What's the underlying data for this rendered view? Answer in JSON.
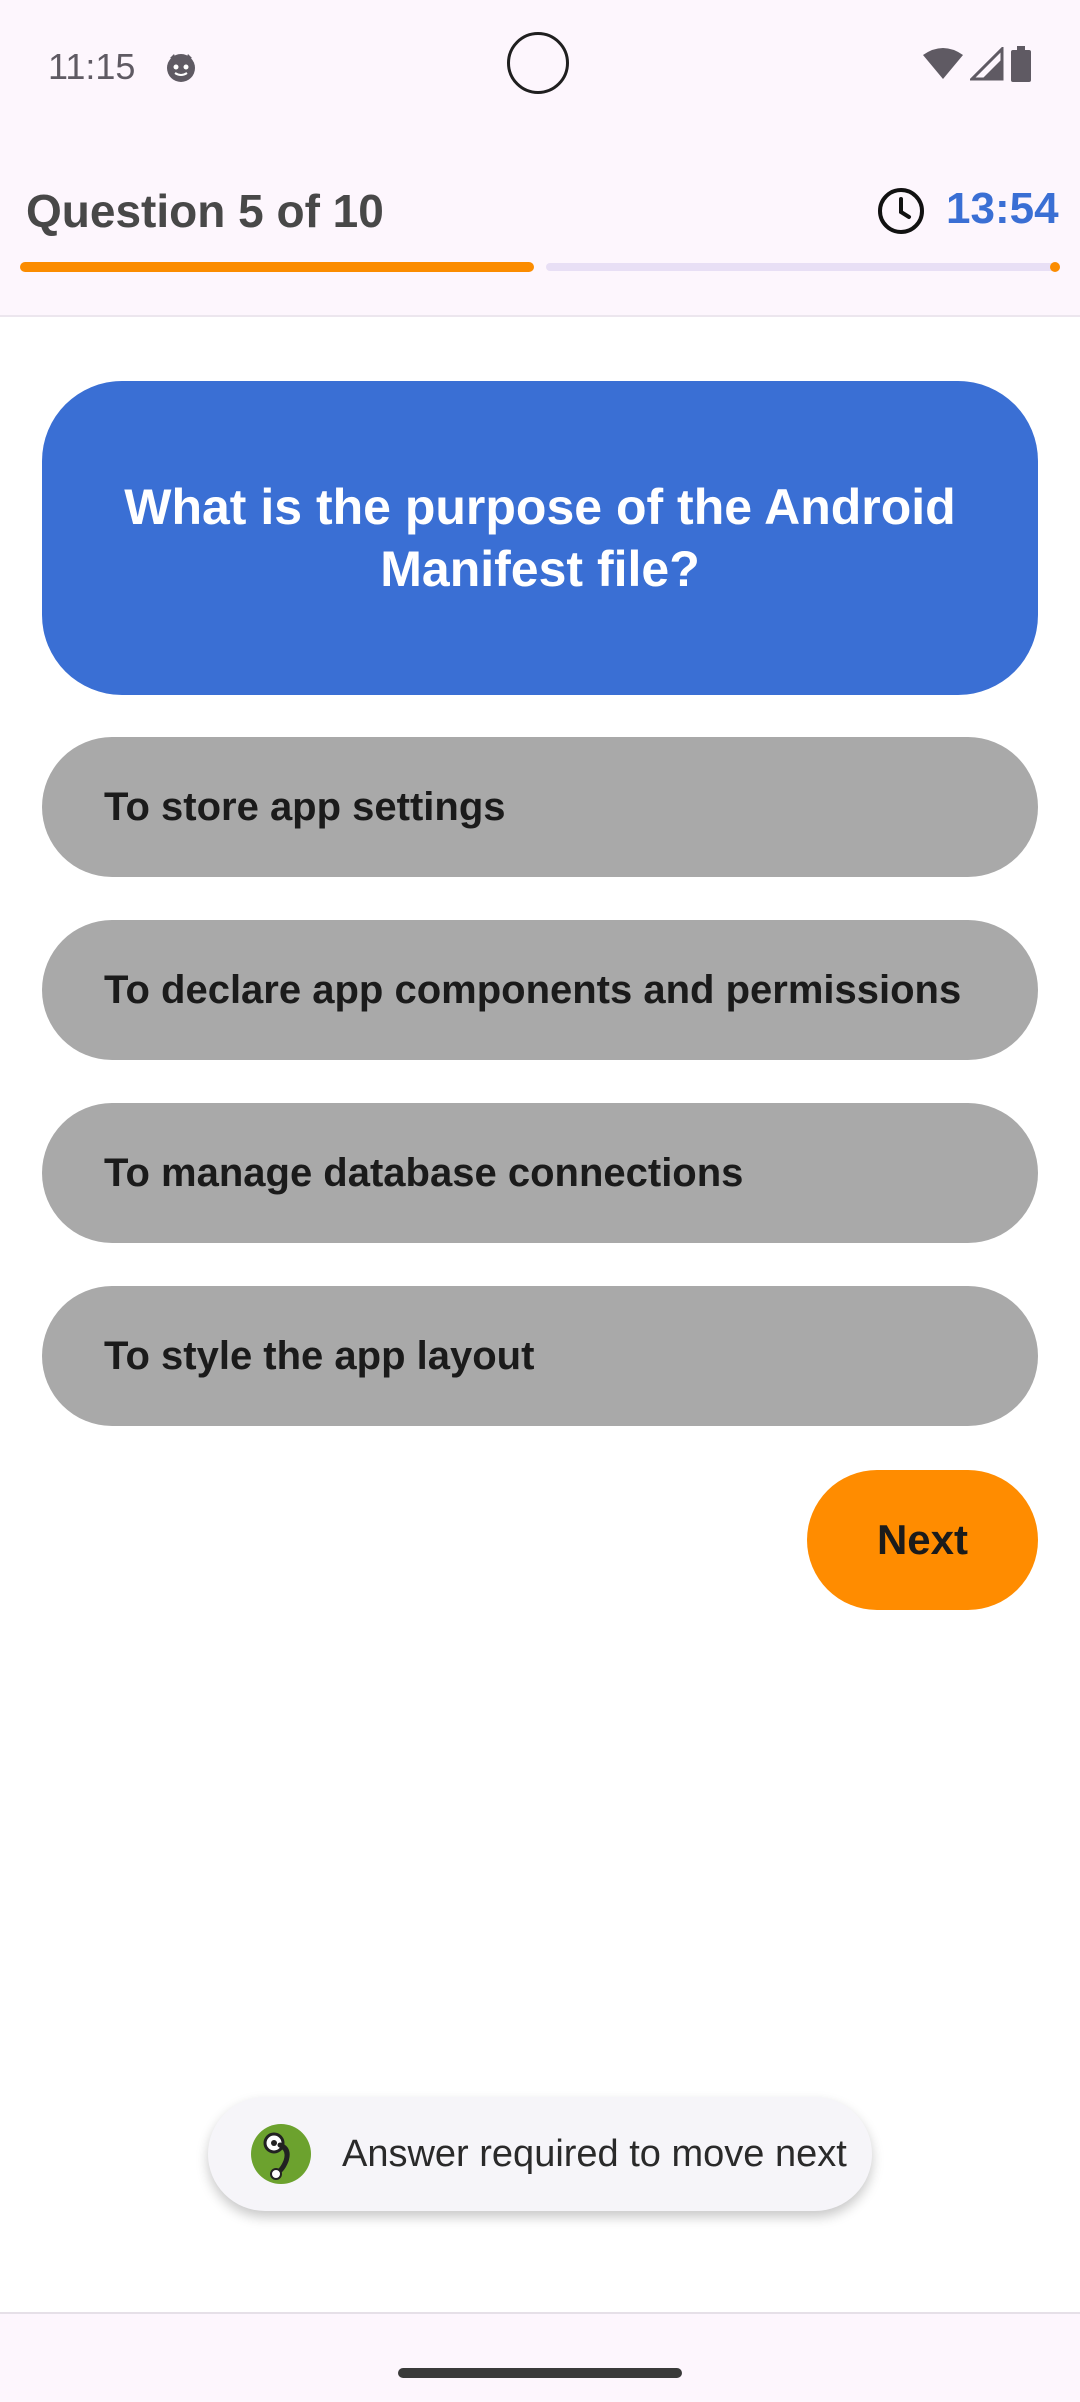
{
  "status_bar": {
    "time": "11:15"
  },
  "header": {
    "question_counter": "Question 5 of 10",
    "timer": "13:54",
    "progress": 0.5
  },
  "question": {
    "text": "What is the purpose of the Android Manifest file?"
  },
  "options": [
    {
      "label": "To store app settings"
    },
    {
      "label": "To declare app components and permissions"
    },
    {
      "label": "To manage database connections"
    },
    {
      "label": "To style the app layout"
    }
  ],
  "actions": {
    "next_label": "Next"
  },
  "toast": {
    "message": "Answer required to move next"
  },
  "colors": {
    "accent_blue": "#3a6fd4",
    "accent_orange": "#fb8c00",
    "option_gray": "#a9a9a9"
  }
}
